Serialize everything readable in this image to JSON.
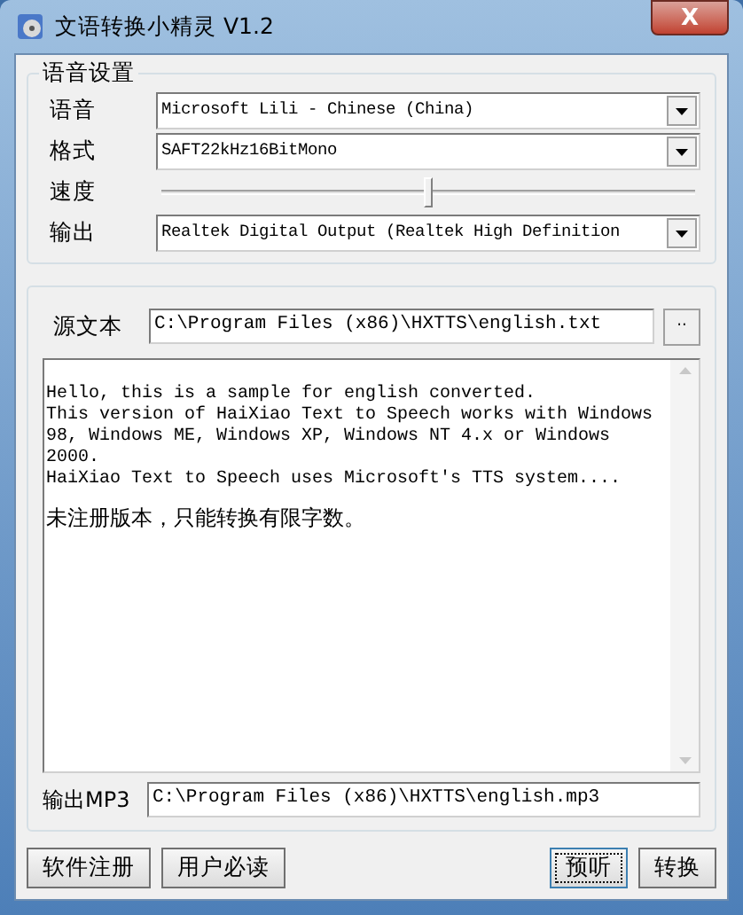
{
  "window": {
    "title": "文语转换小精灵 V1.2",
    "close": "X"
  },
  "voice_settings": {
    "title": "语音设置",
    "rows": [
      {
        "kind": "combo",
        "label": "语音",
        "value": "Microsoft Lili - Chinese (China)"
      },
      {
        "kind": "combo",
        "label": "格式",
        "value": "SAFT22kHz16BitMono"
      },
      {
        "kind": "slider",
        "label": "速度",
        "level": 0.5
      },
      {
        "kind": "combo",
        "label": "输出",
        "value": "Realtek Digital Output (Realtek High Definition"
      }
    ]
  },
  "source": {
    "label": "源文本",
    "value": "C:\\Program Files (x86)\\HXTTS\\english.txt",
    "browse": "··"
  },
  "text_area": {
    "lines": [
      "Hello, this is a sample for english converted.",
      "This version of HaiXiao Text to Speech works with Windows",
      "98, Windows ME, Windows XP, Windows NT 4.x or Windows",
      "2000.",
      "HaiXiao Text to Speech uses Microsoft's TTS system...."
    ],
    "notice": "未注册版本，只能转换有限字数。"
  },
  "output": {
    "label": "输出MP3",
    "value": "C:\\Program Files (x86)\\HXTTS\\english.mp3"
  },
  "buttons": [
    {
      "label": "软件注册",
      "focused": false
    },
    {
      "label": "用户必读",
      "focused": false
    },
    {
      "label": "预听",
      "focused": true
    },
    {
      "label": "转换",
      "focused": false
    }
  ]
}
